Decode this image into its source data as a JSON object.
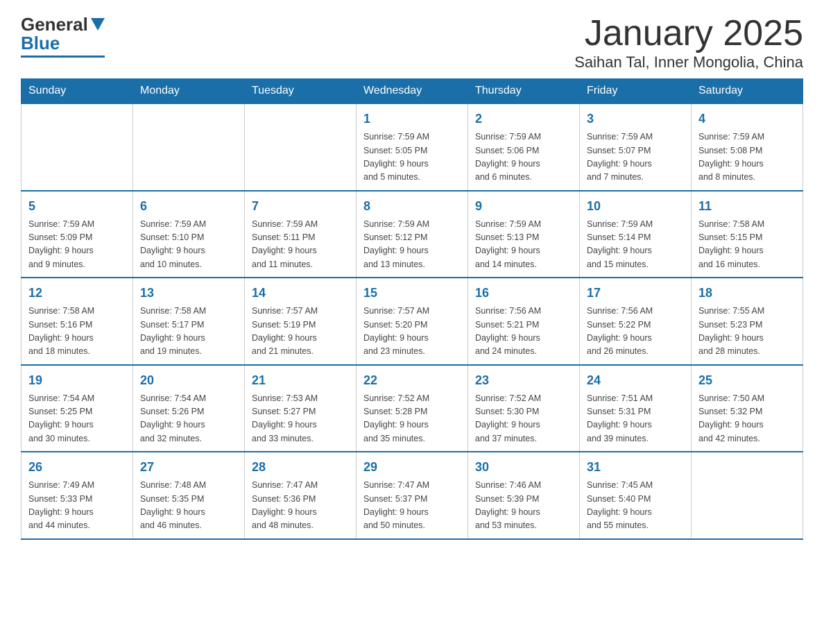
{
  "logo": {
    "general": "General",
    "blue": "Blue"
  },
  "title": "January 2025",
  "location": "Saihan Tal, Inner Mongolia, China",
  "days_of_week": [
    "Sunday",
    "Monday",
    "Tuesday",
    "Wednesday",
    "Thursday",
    "Friday",
    "Saturday"
  ],
  "weeks": [
    [
      {
        "day": "",
        "info": ""
      },
      {
        "day": "",
        "info": ""
      },
      {
        "day": "",
        "info": ""
      },
      {
        "day": "1",
        "info": "Sunrise: 7:59 AM\nSunset: 5:05 PM\nDaylight: 9 hours\nand 5 minutes."
      },
      {
        "day": "2",
        "info": "Sunrise: 7:59 AM\nSunset: 5:06 PM\nDaylight: 9 hours\nand 6 minutes."
      },
      {
        "day": "3",
        "info": "Sunrise: 7:59 AM\nSunset: 5:07 PM\nDaylight: 9 hours\nand 7 minutes."
      },
      {
        "day": "4",
        "info": "Sunrise: 7:59 AM\nSunset: 5:08 PM\nDaylight: 9 hours\nand 8 minutes."
      }
    ],
    [
      {
        "day": "5",
        "info": "Sunrise: 7:59 AM\nSunset: 5:09 PM\nDaylight: 9 hours\nand 9 minutes."
      },
      {
        "day": "6",
        "info": "Sunrise: 7:59 AM\nSunset: 5:10 PM\nDaylight: 9 hours\nand 10 minutes."
      },
      {
        "day": "7",
        "info": "Sunrise: 7:59 AM\nSunset: 5:11 PM\nDaylight: 9 hours\nand 11 minutes."
      },
      {
        "day": "8",
        "info": "Sunrise: 7:59 AM\nSunset: 5:12 PM\nDaylight: 9 hours\nand 13 minutes."
      },
      {
        "day": "9",
        "info": "Sunrise: 7:59 AM\nSunset: 5:13 PM\nDaylight: 9 hours\nand 14 minutes."
      },
      {
        "day": "10",
        "info": "Sunrise: 7:59 AM\nSunset: 5:14 PM\nDaylight: 9 hours\nand 15 minutes."
      },
      {
        "day": "11",
        "info": "Sunrise: 7:58 AM\nSunset: 5:15 PM\nDaylight: 9 hours\nand 16 minutes."
      }
    ],
    [
      {
        "day": "12",
        "info": "Sunrise: 7:58 AM\nSunset: 5:16 PM\nDaylight: 9 hours\nand 18 minutes."
      },
      {
        "day": "13",
        "info": "Sunrise: 7:58 AM\nSunset: 5:17 PM\nDaylight: 9 hours\nand 19 minutes."
      },
      {
        "day": "14",
        "info": "Sunrise: 7:57 AM\nSunset: 5:19 PM\nDaylight: 9 hours\nand 21 minutes."
      },
      {
        "day": "15",
        "info": "Sunrise: 7:57 AM\nSunset: 5:20 PM\nDaylight: 9 hours\nand 23 minutes."
      },
      {
        "day": "16",
        "info": "Sunrise: 7:56 AM\nSunset: 5:21 PM\nDaylight: 9 hours\nand 24 minutes."
      },
      {
        "day": "17",
        "info": "Sunrise: 7:56 AM\nSunset: 5:22 PM\nDaylight: 9 hours\nand 26 minutes."
      },
      {
        "day": "18",
        "info": "Sunrise: 7:55 AM\nSunset: 5:23 PM\nDaylight: 9 hours\nand 28 minutes."
      }
    ],
    [
      {
        "day": "19",
        "info": "Sunrise: 7:54 AM\nSunset: 5:25 PM\nDaylight: 9 hours\nand 30 minutes."
      },
      {
        "day": "20",
        "info": "Sunrise: 7:54 AM\nSunset: 5:26 PM\nDaylight: 9 hours\nand 32 minutes."
      },
      {
        "day": "21",
        "info": "Sunrise: 7:53 AM\nSunset: 5:27 PM\nDaylight: 9 hours\nand 33 minutes."
      },
      {
        "day": "22",
        "info": "Sunrise: 7:52 AM\nSunset: 5:28 PM\nDaylight: 9 hours\nand 35 minutes."
      },
      {
        "day": "23",
        "info": "Sunrise: 7:52 AM\nSunset: 5:30 PM\nDaylight: 9 hours\nand 37 minutes."
      },
      {
        "day": "24",
        "info": "Sunrise: 7:51 AM\nSunset: 5:31 PM\nDaylight: 9 hours\nand 39 minutes."
      },
      {
        "day": "25",
        "info": "Sunrise: 7:50 AM\nSunset: 5:32 PM\nDaylight: 9 hours\nand 42 minutes."
      }
    ],
    [
      {
        "day": "26",
        "info": "Sunrise: 7:49 AM\nSunset: 5:33 PM\nDaylight: 9 hours\nand 44 minutes."
      },
      {
        "day": "27",
        "info": "Sunrise: 7:48 AM\nSunset: 5:35 PM\nDaylight: 9 hours\nand 46 minutes."
      },
      {
        "day": "28",
        "info": "Sunrise: 7:47 AM\nSunset: 5:36 PM\nDaylight: 9 hours\nand 48 minutes."
      },
      {
        "day": "29",
        "info": "Sunrise: 7:47 AM\nSunset: 5:37 PM\nDaylight: 9 hours\nand 50 minutes."
      },
      {
        "day": "30",
        "info": "Sunrise: 7:46 AM\nSunset: 5:39 PM\nDaylight: 9 hours\nand 53 minutes."
      },
      {
        "day": "31",
        "info": "Sunrise: 7:45 AM\nSunset: 5:40 PM\nDaylight: 9 hours\nand 55 minutes."
      },
      {
        "day": "",
        "info": ""
      }
    ]
  ]
}
